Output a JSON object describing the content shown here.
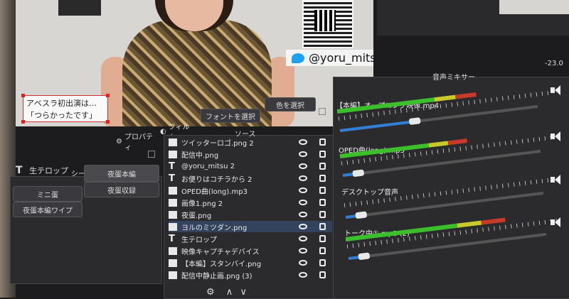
{
  "preview": {
    "twitter_handle": "@yoru_mitsu",
    "telop_line1": "アベスラ初出演は…",
    "telop_line2": "「つらかったです」"
  },
  "toolbar": {
    "properties_label": "プロパティ",
    "filters_label": "フィルタ",
    "font_select_label": "フォントを選択",
    "color_select_label": "色を選択"
  },
  "selected_source_label": "生テロップ",
  "scenes": {
    "header": "シーン",
    "items": [
      "夜蛋本編",
      "ミニ蛋",
      "夜蛋収録",
      "夜蛋本編ワイプ"
    ]
  },
  "sources": {
    "header": "ソース",
    "items": [
      {
        "label": "ツイッターロゴ.png 2",
        "icon": "image-icon"
      },
      {
        "label": "配信中.png",
        "icon": "image-icon"
      },
      {
        "label": "@yoru_mitsu 2",
        "icon": "text-icon"
      },
      {
        "label": "お便りはコチラから 2",
        "icon": "text-icon"
      },
      {
        "label": "OPED曲(long).mp3",
        "icon": "media-icon"
      },
      {
        "label": "画像1.png 2",
        "icon": "image-icon"
      },
      {
        "label": "夜蛋.png",
        "icon": "image-icon"
      },
      {
        "label": "ヨルのミツダン.png",
        "icon": "image-icon"
      },
      {
        "label": "生テロップ",
        "icon": "text-icon"
      },
      {
        "label": "映像キャプチャデバイス",
        "icon": "camera-icon"
      },
      {
        "label": "【本編】スタンバイ.png",
        "icon": "image-icon"
      },
      {
        "label": "配信中静止画.png (3)",
        "icon": "image-icon"
      }
    ]
  },
  "mixer": {
    "header": "音声ミキサー",
    "db_readout": "-23.0",
    "tracks": [
      {
        "name": "【本編】オープニング映像.mp4",
        "level": 0.68,
        "volume": 0.35
      },
      {
        "name": "OPED曲(long).mp3",
        "level": 0.62,
        "volume": 0.05
      },
      {
        "name": "デスクトップ音声",
        "level": 0.0,
        "volume": 0.05
      },
      {
        "name": "トーク中① mp3 (2)",
        "level": 0.78,
        "volume": 0.05
      }
    ]
  },
  "colors": {
    "accent_blue": "#2f7fd6",
    "meter_green": "#3bbf2b",
    "selection": "#33435e"
  }
}
